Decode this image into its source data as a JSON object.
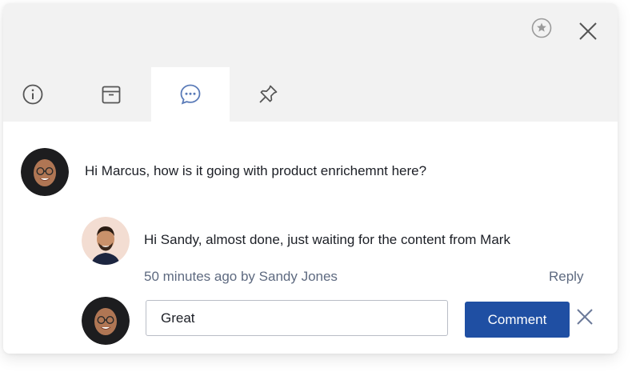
{
  "header": {
    "favorite_icon": "star-circle-icon",
    "close_icon": "close-icon",
    "tabs": [
      {
        "name": "info",
        "icon": "info-icon",
        "active": false
      },
      {
        "name": "details",
        "icon": "box-icon",
        "active": false
      },
      {
        "name": "comments",
        "icon": "chat-icon",
        "active": true
      },
      {
        "name": "pin",
        "icon": "pin-icon",
        "active": false
      }
    ]
  },
  "thread": {
    "comment": {
      "author_avatar": "avatar-sandy",
      "text": "Hi Marcus, how is it going with product enrichemnt here?"
    },
    "reply": {
      "author_avatar": "avatar-marcus",
      "text": "Hi Sandy, almost done, just waiting for the content from Mark",
      "meta": "50 minutes ago by Sandy Jones",
      "reply_label": "Reply"
    }
  },
  "composer": {
    "author_avatar": "avatar-sandy",
    "value": "Great",
    "submit_label": "Comment",
    "cancel_icon": "close-icon"
  },
  "colors": {
    "accent": "#1f4fa3",
    "header_bg": "#f2f2f2",
    "meta_text": "#5e6a80",
    "icon_tint": "#5a7bb8"
  }
}
